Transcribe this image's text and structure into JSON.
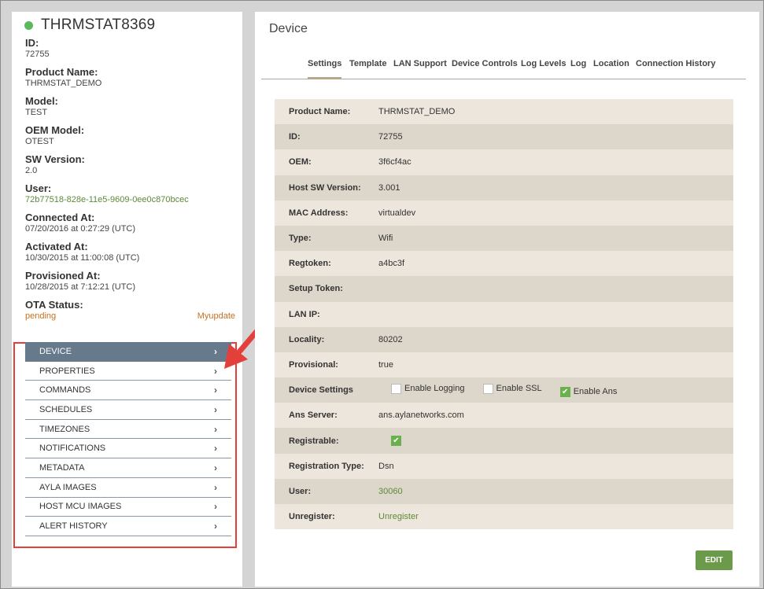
{
  "device": {
    "name": "THRMSTAT8369",
    "status_color": "#5cb85c",
    "info": [
      {
        "label": "ID:",
        "value": "72755",
        "style": ""
      },
      {
        "label": "Product Name:",
        "value": "THRMSTAT_DEMO",
        "style": ""
      },
      {
        "label": "Model:",
        "value": "TEST",
        "style": ""
      },
      {
        "label": "OEM Model:",
        "value": "OTEST",
        "style": ""
      },
      {
        "label": "SW Version:",
        "value": "2.0",
        "style": ""
      },
      {
        "label": "User:",
        "value": "72b77518-828e-11e5-9609-0ee0c870bcec",
        "style": "green"
      },
      {
        "label": "Connected At:",
        "value": "07/20/2016 at 0:27:29 (UTC)",
        "style": ""
      },
      {
        "label": "Activated At:",
        "value": "10/30/2015 at 11:00:08 (UTC)",
        "style": ""
      },
      {
        "label": "Provisioned At:",
        "value": "10/28/2015 at 7:12:21 (UTC)",
        "style": ""
      }
    ],
    "ota": {
      "label": "OTA Status:",
      "status": "pending",
      "update_link": "Myupdate"
    }
  },
  "menu": {
    "items": [
      "DEVICE",
      "PROPERTIES",
      "COMMANDS",
      "SCHEDULES",
      "TIMEZONES",
      "NOTIFICATIONS",
      "METADATA",
      "AYLA IMAGES",
      "HOST MCU IMAGES",
      "ALERT HISTORY"
    ],
    "chevron": "›"
  },
  "main": {
    "title": "Device",
    "tabs": [
      "Settings",
      "Template",
      "LAN Support",
      "Device Controls",
      "Log Levels",
      "Log",
      "Location",
      "Connection History"
    ],
    "active_tab": "Settings",
    "settings": {
      "product_name": {
        "label": "Product Name:",
        "value": "THRMSTAT_DEMO"
      },
      "id": {
        "label": "ID:",
        "value": "72755"
      },
      "oem": {
        "label": "OEM:",
        "value": "3f6cf4ac"
      },
      "host_sw": {
        "label": "Host SW Version:",
        "value": "3.001"
      },
      "mac": {
        "label": "MAC Address:",
        "value": "virtualdev"
      },
      "type": {
        "label": "Type:",
        "value": "Wifi"
      },
      "regtoken": {
        "label": "Regtoken:",
        "value": "a4bc3f"
      },
      "setup_token": {
        "label": "Setup Token:",
        "value": ""
      },
      "lan_ip": {
        "label": "LAN IP:",
        "value": ""
      },
      "locality": {
        "label": "Locality:",
        "value": "80202"
      },
      "provisional": {
        "label": "Provisional:",
        "value": "true"
      },
      "device_settings": {
        "label": "Device Settings",
        "enable_logging": {
          "label": "Enable Logging",
          "checked": false
        },
        "enable_ssl": {
          "label": "Enable SSL",
          "checked": false
        },
        "enable_ans": {
          "label": "Enable Ans",
          "checked": true
        }
      },
      "ans_server": {
        "label": "Ans Server:",
        "value": "ans.aylanetworks.com"
      },
      "registrable": {
        "label": "Registrable:",
        "checked": true
      },
      "registration_type": {
        "label": "Registration Type:",
        "value": "Dsn"
      },
      "user": {
        "label": "User:",
        "value": "30060"
      },
      "unregister": {
        "label": "Unregister:",
        "value": "Unregister"
      }
    },
    "edit_label": "EDIT"
  },
  "colors": {
    "accent_green": "#6b9a4a",
    "menu_active": "#677a8b",
    "highlight_red": "#e3403c"
  }
}
